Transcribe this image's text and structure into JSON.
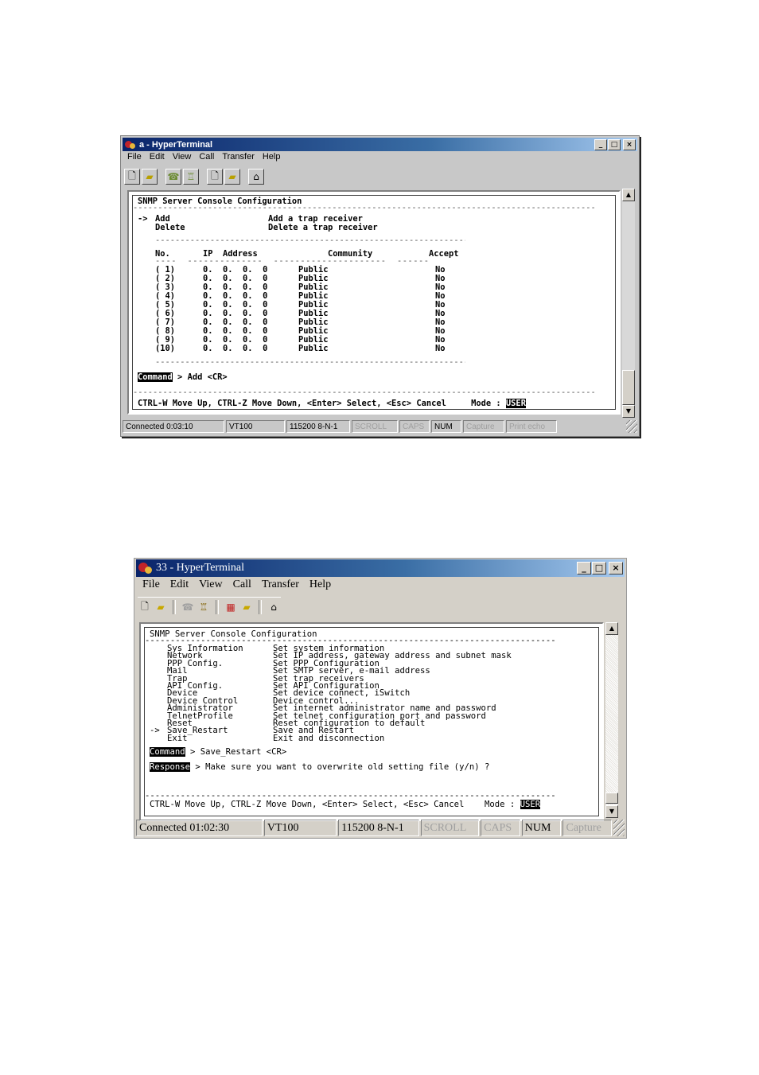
{
  "window1": {
    "title": "a - HyperTerminal",
    "caption_buttons": {
      "minimize": "_",
      "maximize": "□",
      "close": "×"
    },
    "menu": [
      "File",
      "Edit",
      "View",
      "Call",
      "Transfer",
      "Help"
    ],
    "toolbar_icons": [
      "new-icon",
      "open-icon",
      "disconnect-icon",
      "dial-icon",
      "send-icon",
      "receive-icon",
      "properties-icon"
    ],
    "terminal": {
      "heading": "SNMP Server Console Configuration",
      "rule": "---------------------------------------------------------------------------------------------",
      "menu_lines": [
        {
          "cursor": "->",
          "item": "Add",
          "desc": "Add a trap receiver"
        },
        {
          "cursor": "",
          "item": "Delete",
          "desc": "Delete a trap receiver"
        }
      ],
      "table_rule": "---------------------------------------------------------------------------",
      "table_header": {
        "no": "No.",
        "ip": "IP  Address",
        "community": "Community",
        "accept": "Accept"
      },
      "header_underline": "----  --------------  ---------------------  ------",
      "rows": [
        {
          "no": "( 1)",
          "ip": "0.  0.  0.  0",
          "community": "Public",
          "accept": "No"
        },
        {
          "no": "( 2)",
          "ip": "0.  0.  0.  0",
          "community": "Public",
          "accept": "No"
        },
        {
          "no": "( 3)",
          "ip": "0.  0.  0.  0",
          "community": "Public",
          "accept": "No"
        },
        {
          "no": "( 4)",
          "ip": "0.  0.  0.  0",
          "community": "Public",
          "accept": "No"
        },
        {
          "no": "( 5)",
          "ip": "0.  0.  0.  0",
          "community": "Public",
          "accept": "No"
        },
        {
          "no": "( 6)",
          "ip": "0.  0.  0.  0",
          "community": "Public",
          "accept": "No"
        },
        {
          "no": "( 7)",
          "ip": "0.  0.  0.  0",
          "community": "Public",
          "accept": "No"
        },
        {
          "no": "( 8)",
          "ip": "0.  0.  0.  0",
          "community": "Public",
          "accept": "No"
        },
        {
          "no": "( 9)",
          "ip": "0.  0.  0.  0",
          "community": "Public",
          "accept": "No"
        },
        {
          "no": "(10)",
          "ip": "0.  0.  0.  0",
          "community": "Public",
          "accept": "No"
        }
      ],
      "command_label": "Command",
      "command_text": " > Add <CR>",
      "footer": "CTRL-W Move Up, CTRL-Z Move Down, <Enter> Select, <Esc> Cancel     Mode : ",
      "mode": "USER"
    },
    "status": [
      "Connected 0:03:10",
      "VT100",
      "115200 8-N-1",
      "SCROLL",
      "CAPS",
      "NUM",
      "Capture",
      "Print echo"
    ],
    "status_active": [
      true,
      true,
      true,
      false,
      false,
      true,
      false,
      false
    ]
  },
  "window2": {
    "title": "33 - HyperTerminal",
    "caption_buttons": {
      "minimize": "_",
      "maximize": "□",
      "close": "×"
    },
    "menu": [
      "File",
      "Edit",
      "View",
      "Call",
      "Transfer",
      "Help"
    ],
    "toolbar_icons": [
      "new-icon",
      "open-icon",
      "disconnect-icon",
      "dial-icon",
      "send-icon",
      "receive-icon",
      "properties-icon"
    ],
    "terminal": {
      "heading": "SNMP Server Console Configuration",
      "rule": "---------------------------------------------------------------------------------",
      "menu_lines": [
        {
          "cursor": "",
          "item": "Sys Information",
          "desc": "Set system information"
        },
        {
          "cursor": "",
          "item": "Network",
          "desc": "Set IP address, gateway address and subnet mask"
        },
        {
          "cursor": "",
          "item": "PPP Config.",
          "desc": "Set PPP Configuration"
        },
        {
          "cursor": "",
          "item": "Mail",
          "desc": "Set SMTP server, e-mail address"
        },
        {
          "cursor": "",
          "item": "Trap",
          "desc": "Set trap receivers"
        },
        {
          "cursor": "",
          "item": "API Config.",
          "desc": "Set API Configuration"
        },
        {
          "cursor": "",
          "item": "Device",
          "desc": "Set device connect, iSwitch"
        },
        {
          "cursor": "",
          "item": "Device Control",
          "desc": "Device control..."
        },
        {
          "cursor": "",
          "item": "Administrator",
          "desc": "Set internet administrator name and password"
        },
        {
          "cursor": "",
          "item": "TelnetProfile",
          "desc": "Set telnet configuration port and password"
        },
        {
          "cursor": "",
          "item": "Reset",
          "desc": "Reset configuration to default"
        },
        {
          "cursor": "->",
          "item": "Save_Restart",
          "desc": "Save and Restart"
        },
        {
          "cursor": "",
          "item": "Exit",
          "desc": "Exit and disconnection"
        }
      ],
      "command_label": "Command",
      "command_text": " > Save_Restart <CR>",
      "response_label": "Response",
      "response_text": " > Make sure you want to overwrite old setting file (y/n) ?",
      "footer": "CTRL-W Move Up, CTRL-Z Move Down, <Enter> Select, <Esc> Cancel    Mode : ",
      "mode": "USER"
    },
    "status": [
      "Connected 01:02:30",
      "VT100",
      "115200 8-N-1",
      "SCROLL",
      "CAPS",
      "NUM",
      "Capture"
    ],
    "status_active": [
      true,
      true,
      true,
      false,
      false,
      true,
      false
    ]
  }
}
